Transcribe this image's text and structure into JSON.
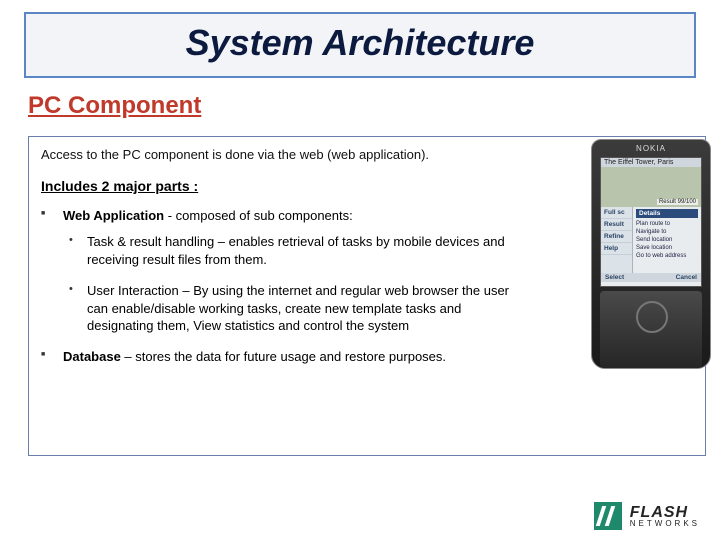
{
  "title": "System Architecture",
  "subtitle": "PC Component",
  "intro": "Access to the PC component is done via the web (web application).",
  "includes_label": "Includes 2 major parts :",
  "parts": [
    {
      "lead": "Web Application",
      "tail": " - composed of sub components:",
      "sub": [
        "Task & result handling – enables retrieval of tasks by mobile devices and receiving result files from them.",
        "User Interaction – By using the internet and regular web browser the user can enable/disable working tasks, create new template tasks and designating them, View statistics and control the system"
      ]
    },
    {
      "lead": "Database",
      "tail": " – stores the data for future usage and restore purposes.",
      "sub": []
    }
  ],
  "phone": {
    "brand": "NOKIA",
    "topbar_left": "The Eiffel Tower, Paris",
    "result_label": "Result 99/100",
    "menu": [
      "Full sc",
      "Result",
      "Refine",
      "Help"
    ],
    "pane_header": "Details",
    "pane_lines": [
      "Plan route to",
      "Navigate to",
      "Send location",
      "Save location",
      "Go to web address"
    ],
    "soft_left": "Select",
    "soft_right": "Cancel"
  },
  "logo": {
    "line1": "FLASH",
    "line2": "NETWORKS"
  }
}
